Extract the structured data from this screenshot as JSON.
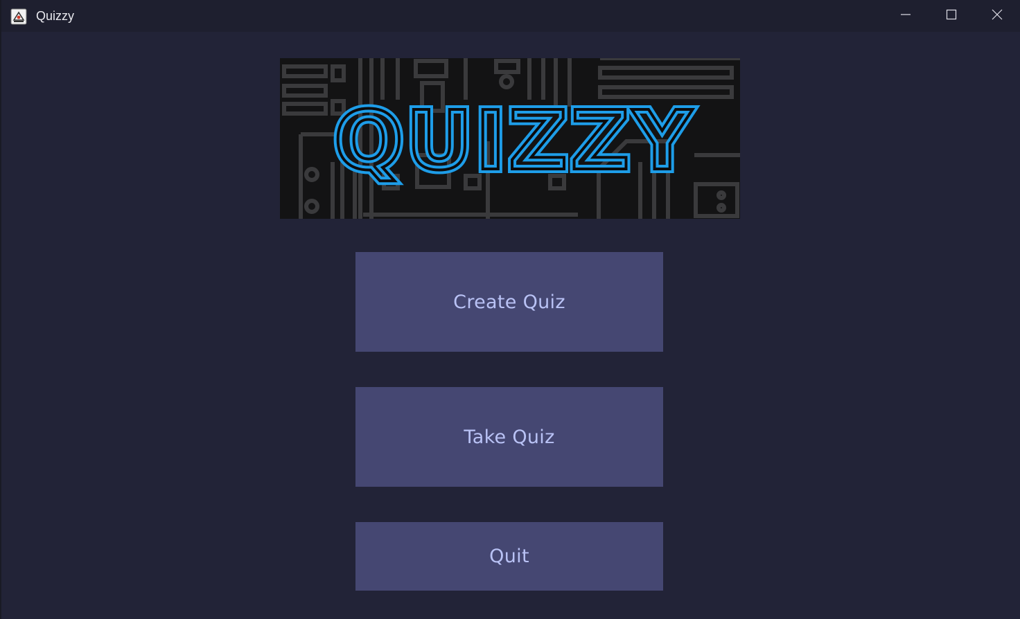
{
  "window": {
    "title": "Quizzy",
    "app_icon": "java-app-icon",
    "controls": {
      "minimize_icon": "minimize-icon",
      "maximize_icon": "maximize-icon",
      "close_icon": "close-icon"
    }
  },
  "banner": {
    "logo_text": "QUIZZY",
    "logo_color": "#1e9de8",
    "background_color": "#131314"
  },
  "menu": {
    "create_quiz_label": "Create Quiz",
    "take_quiz_label": "Take Quiz",
    "quit_label": "Quit"
  },
  "colors": {
    "window_background": "#222337",
    "titlebar_background": "#1e1f2f",
    "button_background": "#454772",
    "button_text": "#b9c2f5"
  }
}
